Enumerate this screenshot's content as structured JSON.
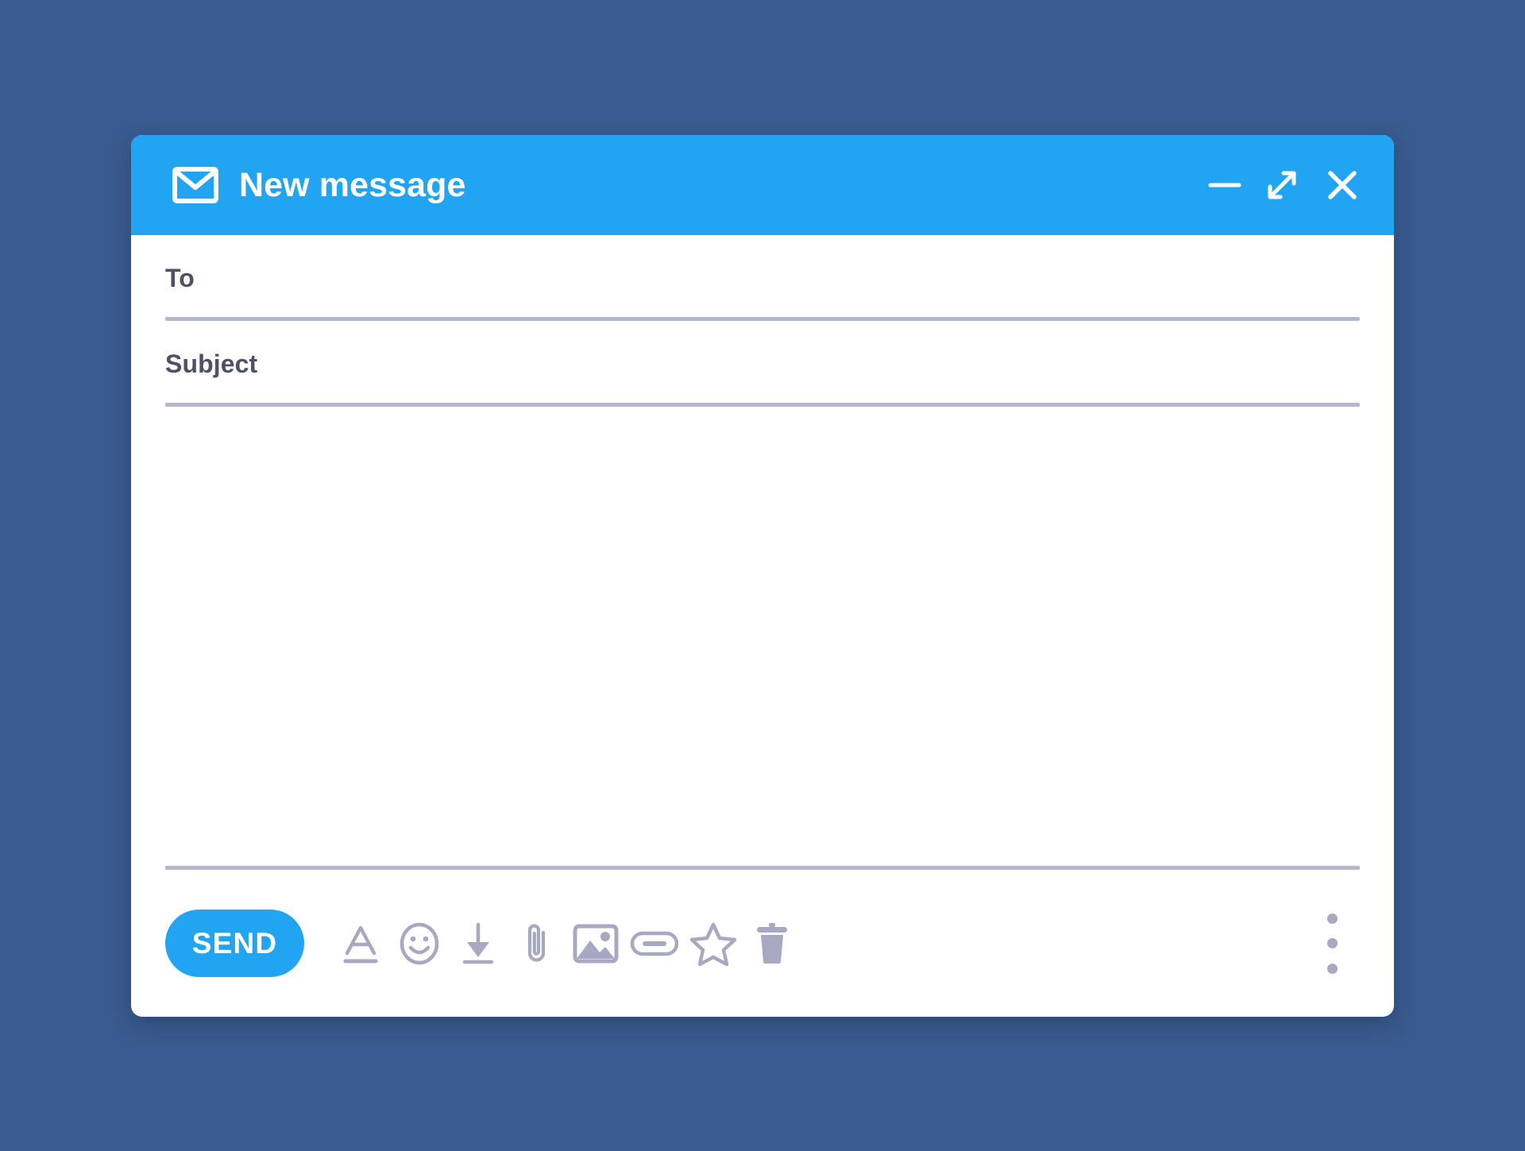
{
  "theme": {
    "desktop_background": "#3a5b8f",
    "header_blue": "#21a5f2",
    "accent_blue": "#21a5f2",
    "window_background": "#ffffff",
    "label_text": "#4e5068",
    "divider": "#b6b6cd",
    "icon_gray": "#a8a8c2"
  },
  "window": {
    "title": "New message",
    "icon": "envelope-icon",
    "controls": [
      {
        "name": "minimize-button",
        "icon": "minimize-icon",
        "label": "Minimize"
      },
      {
        "name": "maximize-button",
        "icon": "maximize-icon",
        "label": "Maximize"
      },
      {
        "name": "close-button",
        "icon": "close-icon",
        "label": "Close"
      }
    ]
  },
  "fields": {
    "to": {
      "label": "To",
      "value": "",
      "placeholder": ""
    },
    "subject": {
      "label": "Subject",
      "value": "",
      "placeholder": ""
    },
    "body": {
      "value": "",
      "placeholder": ""
    }
  },
  "toolbar": {
    "send_label": "SEND",
    "icons": [
      {
        "name": "format-text-icon",
        "label": "Formatting options"
      },
      {
        "name": "emoji-icon",
        "label": "Insert emoji"
      },
      {
        "name": "insert-from-drive-icon",
        "label": "Insert from Drive"
      },
      {
        "name": "attach-file-icon",
        "label": "Attach files"
      },
      {
        "name": "insert-photo-icon",
        "label": "Insert photo"
      },
      {
        "name": "insert-link-icon",
        "label": "Insert link"
      },
      {
        "name": "star-icon",
        "label": "Star"
      },
      {
        "name": "delete-icon",
        "label": "Discard draft"
      }
    ],
    "more_options_label": "More options",
    "more_options_icon": "more-vertical-icon"
  }
}
